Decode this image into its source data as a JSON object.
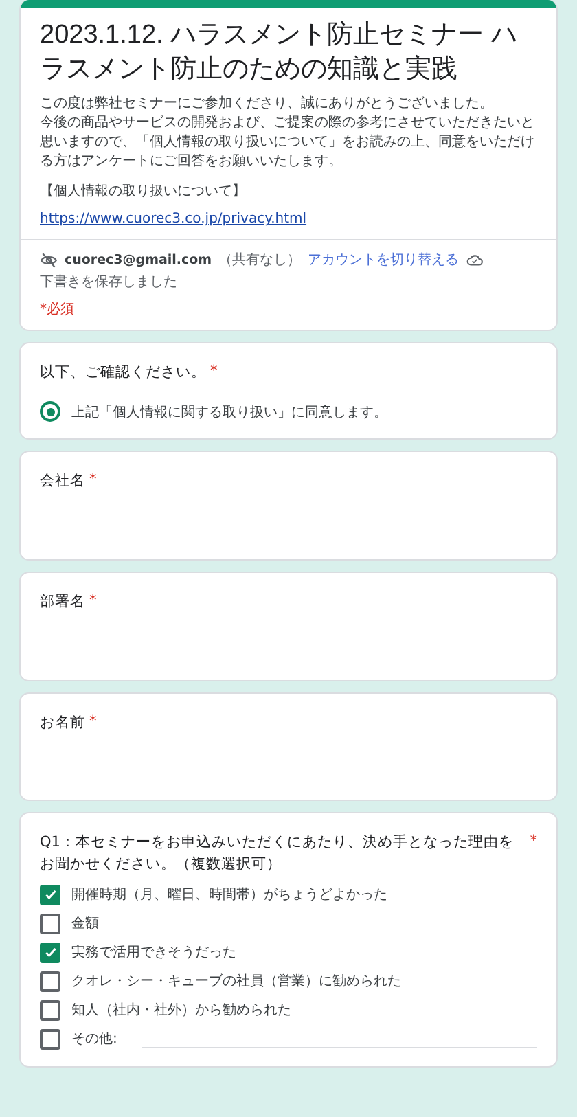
{
  "header": {
    "title": "2023.1.12. ハラスメント防止セミナー ハラスメント防止のための知識と実践",
    "description": [
      "この度は弊社セミナーにご参加くださり、誠にありがとうございました。",
      "今後の商品やサービスの開発および、ご提案の際の参考にさせていただきたいと思いますので、「個人情報の取り扱いについて」をお読みの上、同意をいただける方はアンケートにご回答をお願いいたします。"
    ],
    "privacy_heading": "【個人情報の取り扱いについて】",
    "privacy_link": "https://www.cuorec3.co.jp/privacy.html",
    "account": {
      "email": "cuorec3@gmail.com",
      "sharing": "（共有なし）",
      "switch_link": "アカウントを切り替える",
      "draft_status": "下書きを保存しました"
    },
    "required_note": "*必須"
  },
  "questions": [
    {
      "kind": "radio",
      "label": "以下、ご確認ください。",
      "required_mark": "*",
      "options": [
        {
          "label": "上記「個人情報に関する取り扱い」に同意します。",
          "selected": true
        }
      ]
    },
    {
      "kind": "text",
      "label": "会社名",
      "required_mark": "*"
    },
    {
      "kind": "text",
      "label": "部署名",
      "required_mark": "*"
    },
    {
      "kind": "text",
      "label": "お名前",
      "required_mark": "*"
    },
    {
      "kind": "checkbox",
      "label": "Q1：本セミナーをお申込みいただくにあたり、決め手となった理由をお聞かせください。（複数選択可）",
      "required_mark": "*",
      "options": [
        {
          "label": "開催時期（月、曜日、時間帯）がちょうどよかった",
          "checked": true
        },
        {
          "label": "金額",
          "checked": false
        },
        {
          "label": "実務で活用できそうだった",
          "checked": true
        },
        {
          "label": "クオレ・シー・キューブの社員（営業）に勧められた",
          "checked": false
        },
        {
          "label": "知人（社内・社外）から勧められた",
          "checked": false
        },
        {
          "label": "その他:",
          "checked": false,
          "kind": "other"
        }
      ]
    }
  ]
}
